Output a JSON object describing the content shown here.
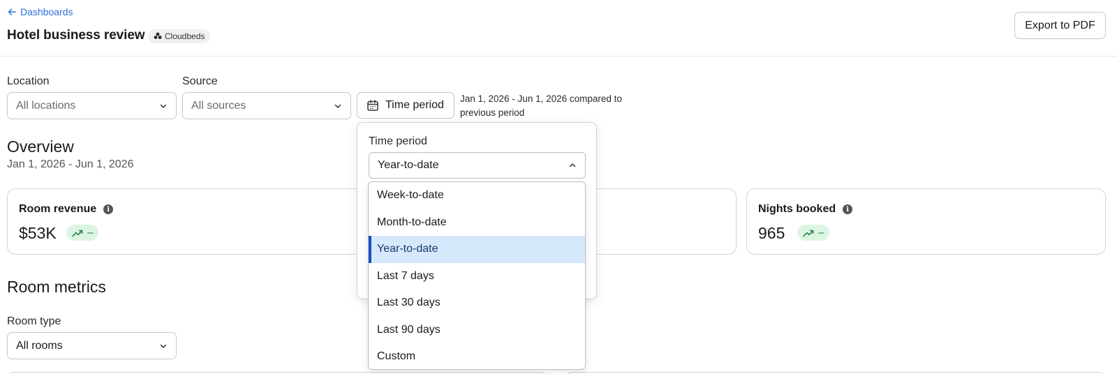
{
  "header": {
    "back_label": "Dashboards",
    "title": "Hotel business review",
    "source_badge": "Cloudbeds",
    "export_label": "Export to PDF"
  },
  "filters": {
    "location": {
      "label": "Location",
      "value": "All locations"
    },
    "source": {
      "label": "Source",
      "value": "All sources"
    },
    "time_period_button": "Time period",
    "period_description": "Jan 1, 2026 - Jun 1, 2026 compared to previous period"
  },
  "overview": {
    "title": "Overview",
    "date_range": "Jan 1, 2026 - Jun 1, 2026",
    "cards": [
      {
        "label": "Room revenue",
        "value": "$53K",
        "trend": "–"
      },
      {
        "label": "Nights booked",
        "value": "965",
        "trend": "–"
      }
    ]
  },
  "room_metrics": {
    "title": "Room metrics",
    "room_type": {
      "label": "Room type",
      "value": "All rooms"
    }
  },
  "time_period_popover": {
    "label": "Time period",
    "selected": "Year-to-date",
    "options": [
      "Week-to-date",
      "Month-to-date",
      "Year-to-date",
      "Last 7 days",
      "Last 30 days",
      "Last 90 days",
      "Custom"
    ],
    "selected_index": 2
  },
  "colors": {
    "link": "#2f6fd6",
    "trend_bg": "#dcf5e3",
    "trend_fg": "#1f7a3d",
    "selected_bg": "#d6e8fb",
    "selected_accent": "#1b4fc2"
  }
}
